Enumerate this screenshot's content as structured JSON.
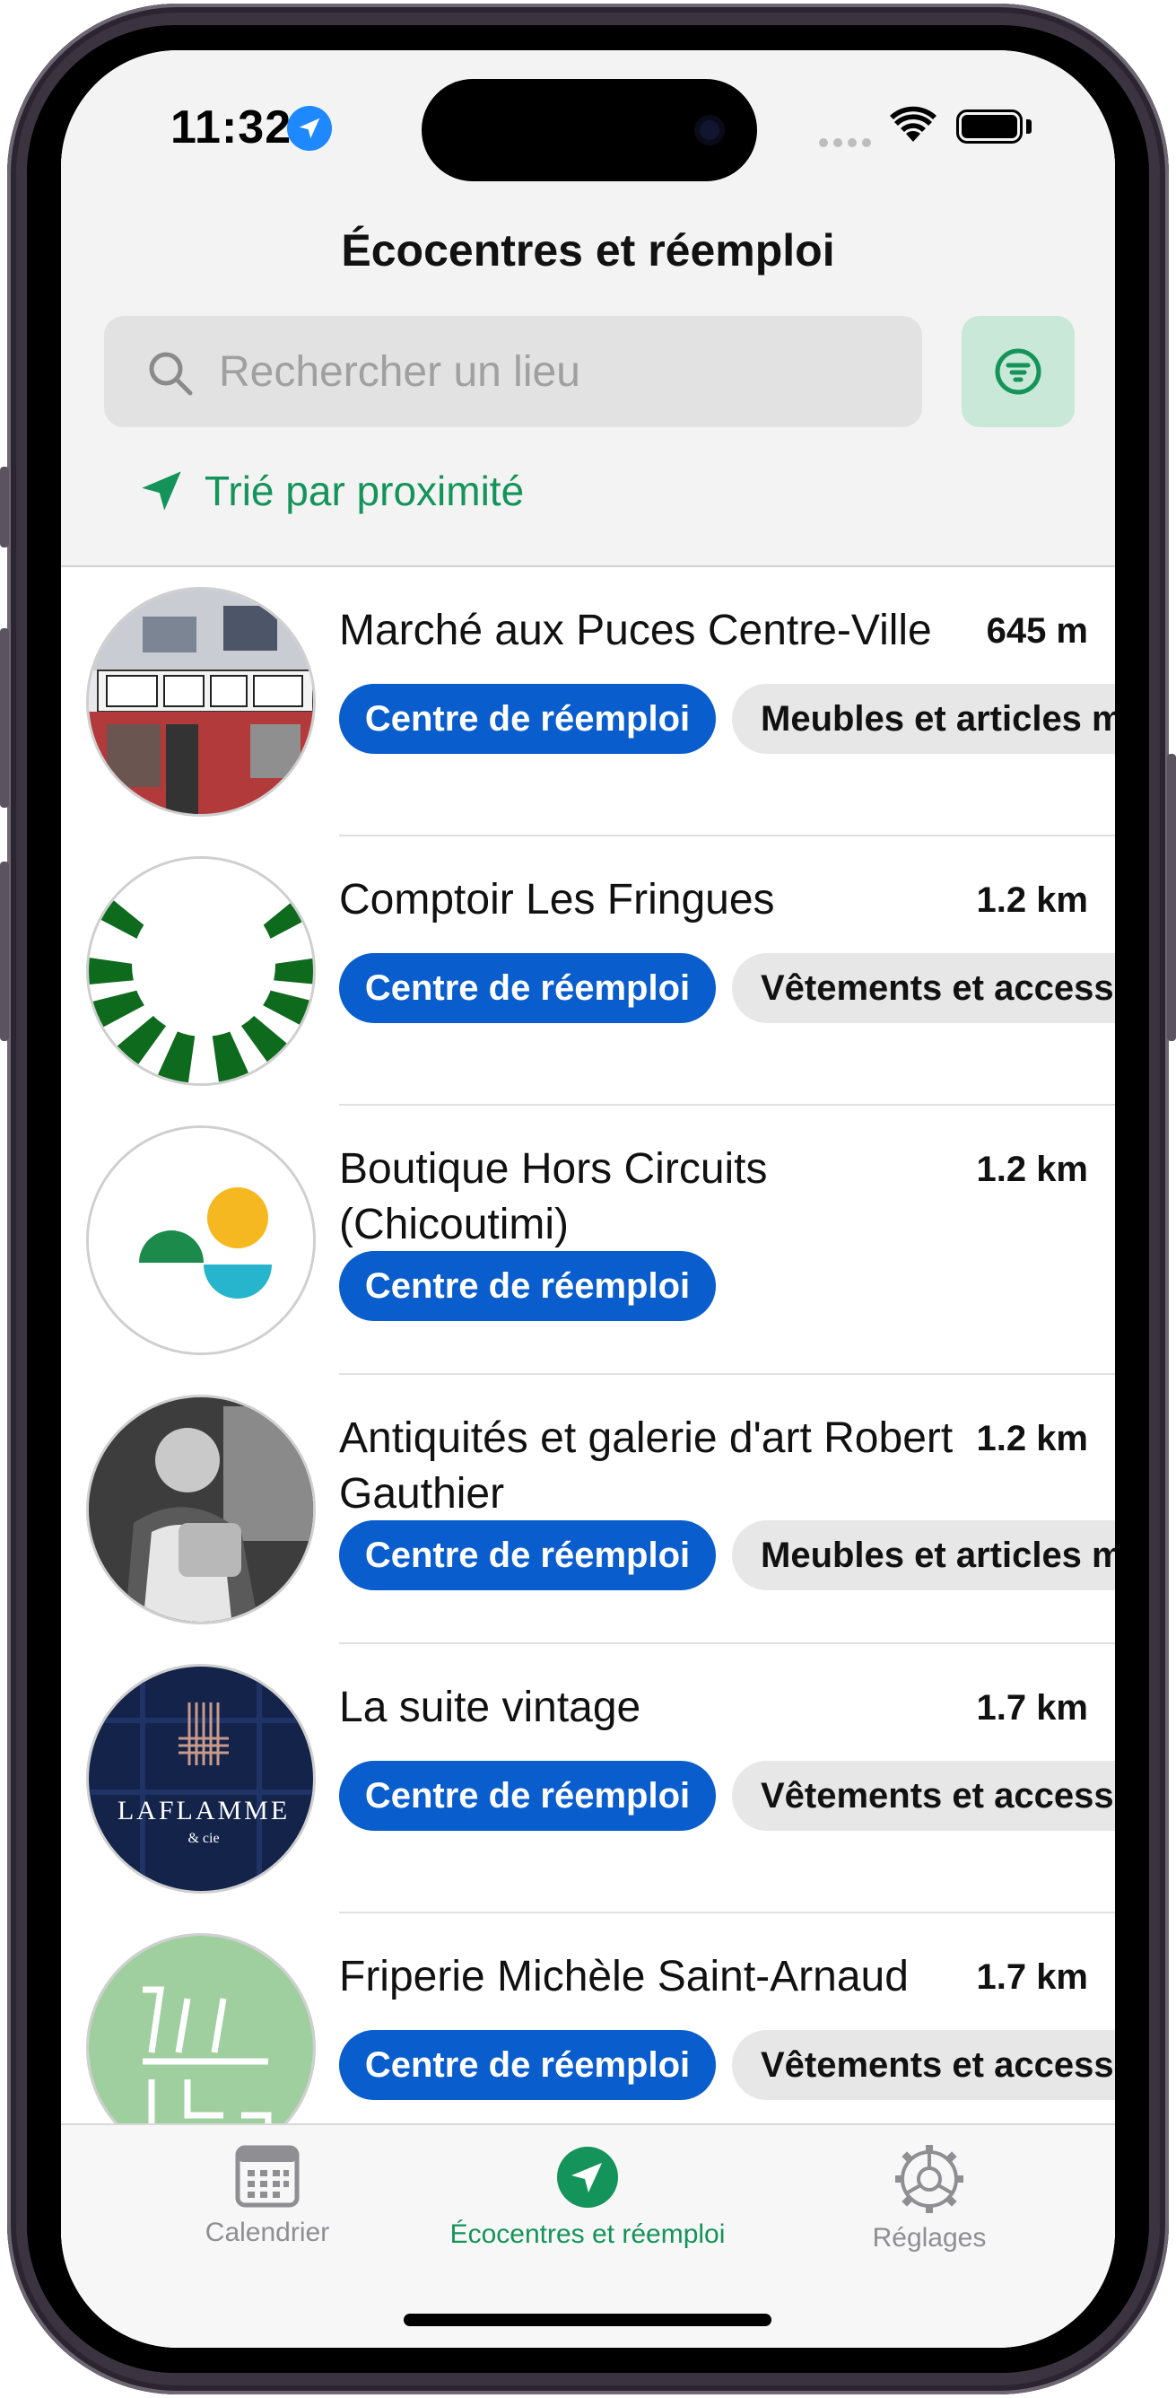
{
  "status_bar": {
    "time": "11:32"
  },
  "header": {
    "title": "Écocentres et réemploi",
    "search_placeholder": "Rechercher un lieu",
    "sort_label": "Trié par proximité"
  },
  "colors": {
    "accent_green": "#14935a",
    "tag_blue": "#0a5dcc",
    "tag_grey": "#e7e7e7"
  },
  "places": [
    {
      "name": "Marché aux Puces Centre-Ville",
      "distance": "645 m",
      "tags": [
        "Centre de réemploi",
        "Meubles et articles m"
      ]
    },
    {
      "name": "Comptoir Les Fringues",
      "distance": "1.2 km",
      "tags": [
        "Centre de réemploi",
        "Vêtements et accesso"
      ]
    },
    {
      "name": "Boutique Hors Circuits (Chicoutimi)",
      "distance": "1.2 km",
      "tags": [
        "Centre de réemploi"
      ]
    },
    {
      "name": "Antiquités et galerie d'art Robert Gauthier",
      "distance": "1.2 km",
      "tags": [
        "Centre de réemploi",
        "Meubles et articles m"
      ]
    },
    {
      "name": "La suite vintage",
      "distance": "1.7 km",
      "tags": [
        "Centre de réemploi",
        "Vêtements et accesso"
      ],
      "logo_text": "LAFLAMME",
      "logo_sub": "& cie"
    },
    {
      "name": "Friperie Michèle Saint-Arnaud",
      "distance": "1.7 km",
      "tags": [
        "Centre de réemploi",
        "Vêtements et accesso"
      ]
    }
  ],
  "tabbar": [
    {
      "label": "Calendrier",
      "icon": "calendar-icon",
      "active": false
    },
    {
      "label": "Écocentres et réemploi",
      "icon": "location-arrow-icon",
      "active": true
    },
    {
      "label": "Réglages",
      "icon": "gear-icon",
      "active": false
    }
  ]
}
